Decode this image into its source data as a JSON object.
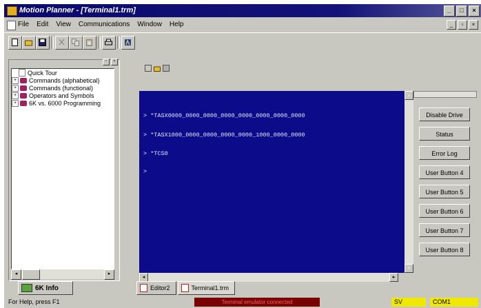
{
  "window": {
    "title": "Motion Planner - [Terminal1.trm]"
  },
  "menu": [
    "File",
    "Edit",
    "View",
    "Communications",
    "Window",
    "Help"
  ],
  "toolbar": {
    "icons": [
      "new-icon",
      "open-icon",
      "save-icon",
      "cut-icon",
      "copy-icon",
      "paste-icon",
      "print-icon",
      "about-icon"
    ]
  },
  "left_panel": {
    "tree": [
      {
        "label": "Quick Tour",
        "type": "page"
      },
      {
        "label": "Commands (alphabetical)",
        "type": "book"
      },
      {
        "label": "Commands (functional)",
        "type": "book"
      },
      {
        "label": "Operators and Symbols",
        "type": "book"
      },
      {
        "label": "6K vs. 6000 Programming",
        "type": "book"
      }
    ],
    "tab_label": "6K Info"
  },
  "terminal": {
    "lines": [
      "> *TASX0000_0000_0000_0000_0000_0000_0000_0000",
      "> *TASX1000_0000_0000_0000_0000_1000_0000_0000",
      "> *TCS0",
      ">"
    ]
  },
  "user_buttons": [
    "Disable Drive",
    "Status",
    "Error Log",
    "User Button 4",
    "User Button 5",
    "User Button 6",
    "User Button 7",
    "User Button 8"
  ],
  "doc_tabs": [
    {
      "label": "Editor2",
      "active": false
    },
    {
      "label": "Terminal1.trm",
      "active": true
    }
  ],
  "status": {
    "help": "For Help, press F1",
    "message": "Terminal emulator connected",
    "sv": "SV",
    "com": "COM1"
  },
  "colors": {
    "terminal_bg": "#0c0c8a",
    "titlebar": "#0a0a6e",
    "status_yellow": "#f0e800",
    "status_red": "#7a0000"
  }
}
